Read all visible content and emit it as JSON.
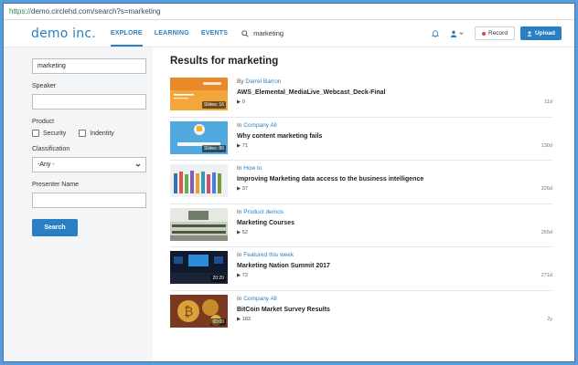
{
  "browser": {
    "protocol": "https://",
    "url_rest": "demo.circlehd.com/search?s=marketing"
  },
  "header": {
    "logo": "demo inc.",
    "nav": [
      "EXPLORE",
      "LEARNING",
      "EVENTS"
    ],
    "search_value": "marketing",
    "record_label": "Record",
    "upload_label": "Upload"
  },
  "sidebar": {
    "query": "marketing",
    "speaker_label": "Speaker",
    "speaker_value": "",
    "product_label": "Product",
    "product_options": [
      "Security",
      "Indentity"
    ],
    "classification_label": "Classification",
    "classification_value": "-Any -",
    "presenter_label": "Presenter Name",
    "presenter_value": "",
    "search_button": "Search"
  },
  "results": {
    "heading": "Results for marketing",
    "items": [
      {
        "prefix": "By",
        "link": "Darrel Barron",
        "title": "AWS_Elemental_MediaLive_Webcast_Deck-Final",
        "views": "▶ 0",
        "age": "11d",
        "badge": "Slides: 16"
      },
      {
        "prefix": "In",
        "link": "Company All",
        "title": "Why content marketing fails",
        "views": "▶ 71",
        "age": "130d",
        "badge": "Slides: 86"
      },
      {
        "prefix": "In",
        "link": "How to",
        "title": "Improving Marketing data access to the business intelligence",
        "views": "▶ 37",
        "age": "226d",
        "badge": ""
      },
      {
        "prefix": "In",
        "link": "Product demos",
        "title": "Marketing Courses",
        "views": "▶ 52",
        "age": "265d",
        "badge": ""
      },
      {
        "prefix": "In",
        "link": "Featured this week",
        "title": "Marketing Nation Summit 2017",
        "views": "▶ 72",
        "age": "271d",
        "badge": "20:20"
      },
      {
        "prefix": "In",
        "link": "Company All",
        "title": "BitCoin Market Survey Results",
        "views": "▶ 183",
        "age": "2y",
        "badge": "00:00"
      }
    ]
  },
  "colors": {
    "accent": "#2a7fc2",
    "record_dot": "#e0433a"
  }
}
